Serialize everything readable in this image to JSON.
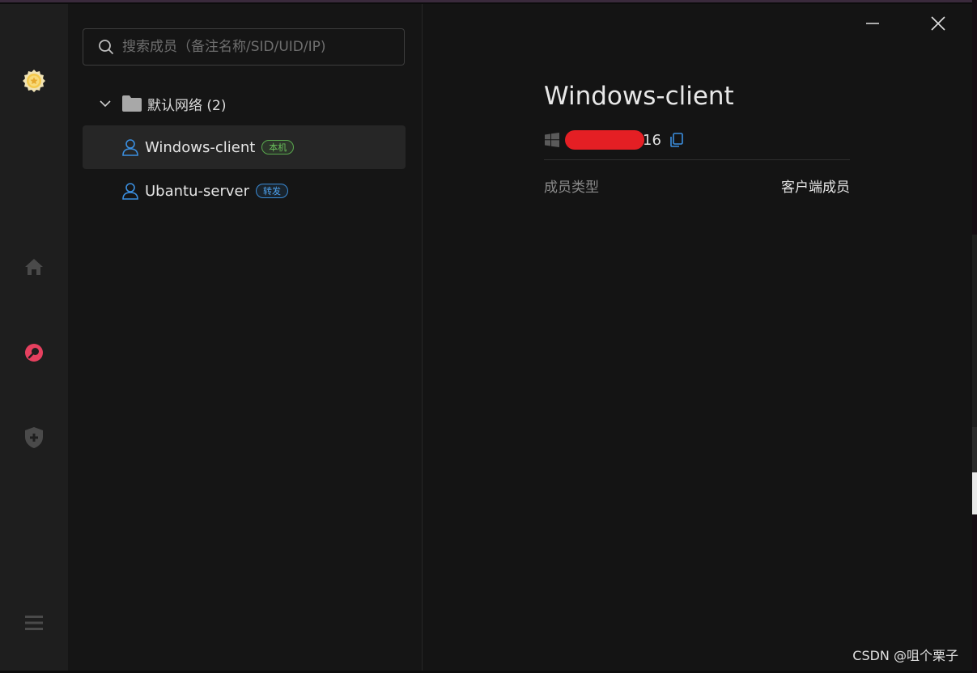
{
  "search": {
    "placeholder": "搜索成员（备注名称/SID/UID/IP)"
  },
  "network": {
    "group_label": "默认网络 (2)",
    "members": [
      {
        "name": "Windows-client",
        "badge": "本机",
        "badge_color": "#6ac05c",
        "selected": true
      },
      {
        "name": "Ubantu-server",
        "badge": "转发",
        "badge_color": "#4ea3f0",
        "selected": false
      }
    ]
  },
  "details": {
    "title": "Windows-client",
    "os_icon": "windows-icon",
    "id_suffix": "16",
    "properties": [
      {
        "label": "成员类型",
        "value": "客户端成员"
      }
    ]
  },
  "sidebar": {
    "icons": [
      "avatar-medal-icon",
      "home-icon",
      "network-icon",
      "shield-plus-icon",
      "menu-icon"
    ],
    "accent": "#e6405f"
  },
  "window_controls": [
    "minimize-icon",
    "close-icon"
  ],
  "watermark": "CSDN @咀个栗子"
}
